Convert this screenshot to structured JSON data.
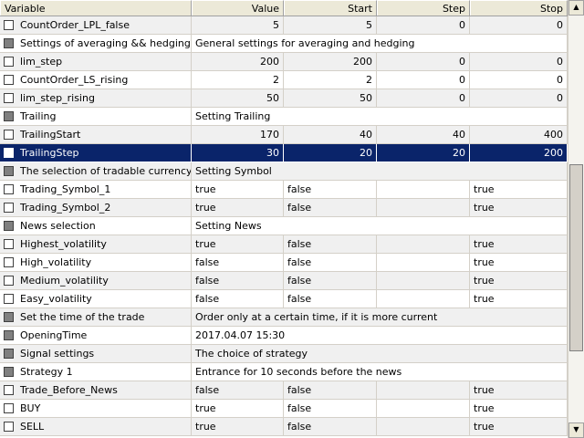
{
  "columns": [
    "Variable",
    "Value",
    "Start",
    "Step",
    "Stop"
  ],
  "rows": [
    {
      "type": "param",
      "name": "CountOrder_LPL_false",
      "value": "5",
      "start": "5",
      "step": "0",
      "stop": "0"
    },
    {
      "type": "group",
      "name": "Settings of averaging && hedging, if...",
      "desc": "General settings for averaging and hedging"
    },
    {
      "type": "param",
      "name": "lim_step",
      "value": "200",
      "start": "200",
      "step": "0",
      "stop": "0"
    },
    {
      "type": "param",
      "name": "CountOrder_LS_rising",
      "value": "2",
      "start": "2",
      "step": "0",
      "stop": "0"
    },
    {
      "type": "param",
      "name": "lim_step_rising",
      "value": "50",
      "start": "50",
      "step": "0",
      "stop": "0"
    },
    {
      "type": "group",
      "name": "Trailing",
      "desc": "Setting Trailing"
    },
    {
      "type": "param",
      "name": "TrailingStart",
      "value": "170",
      "start": "40",
      "step": "40",
      "stop": "400"
    },
    {
      "type": "param",
      "name": "TrailingStep",
      "value": "30",
      "start": "20",
      "step": "20",
      "stop": "200",
      "selected": true
    },
    {
      "type": "group",
      "name": "The selection of tradable currency",
      "desc": "Setting Symbol"
    },
    {
      "type": "bool",
      "name": "Trading_Symbol_1",
      "value": "true",
      "start": "false",
      "step": "",
      "stop": "true"
    },
    {
      "type": "bool",
      "name": "Trading_Symbol_2",
      "value": "true",
      "start": "false",
      "step": "",
      "stop": "true"
    },
    {
      "type": "group",
      "name": "News selection",
      "desc": "Setting News"
    },
    {
      "type": "bool",
      "name": "Highest_volatility",
      "value": "true",
      "start": "false",
      "step": "",
      "stop": "true"
    },
    {
      "type": "bool",
      "name": "High_volatility",
      "value": "false",
      "start": "false",
      "step": "",
      "stop": "true"
    },
    {
      "type": "bool",
      "name": "Medium_volatility",
      "value": "false",
      "start": "false",
      "step": "",
      "stop": "true"
    },
    {
      "type": "bool",
      "name": "Easy_volatility",
      "value": "false",
      "start": "false",
      "step": "",
      "stop": "true"
    },
    {
      "type": "group",
      "name": "Set the time of the trade",
      "desc": "Order only at a certain time, if it is more current"
    },
    {
      "type": "group",
      "name": "OpeningTime",
      "desc": "2017.04.07 15:30"
    },
    {
      "type": "group",
      "name": "Signal settings",
      "desc": "The choice of strategy"
    },
    {
      "type": "group",
      "name": "Strategy 1",
      "desc": "Entrance for 10 seconds before the news"
    },
    {
      "type": "bool",
      "name": "Trade_Before_News",
      "value": "false",
      "start": "false",
      "step": "",
      "stop": "true"
    },
    {
      "type": "bool",
      "name": "BUY",
      "value": "true",
      "start": "false",
      "step": "",
      "stop": "true"
    },
    {
      "type": "bool",
      "name": "SELL",
      "value": "true",
      "start": "false",
      "step": "",
      "stop": "true"
    }
  ],
  "scrollbar": {
    "up_icon": "arrow-up-icon",
    "down_icon": "arrow-down-icon"
  }
}
